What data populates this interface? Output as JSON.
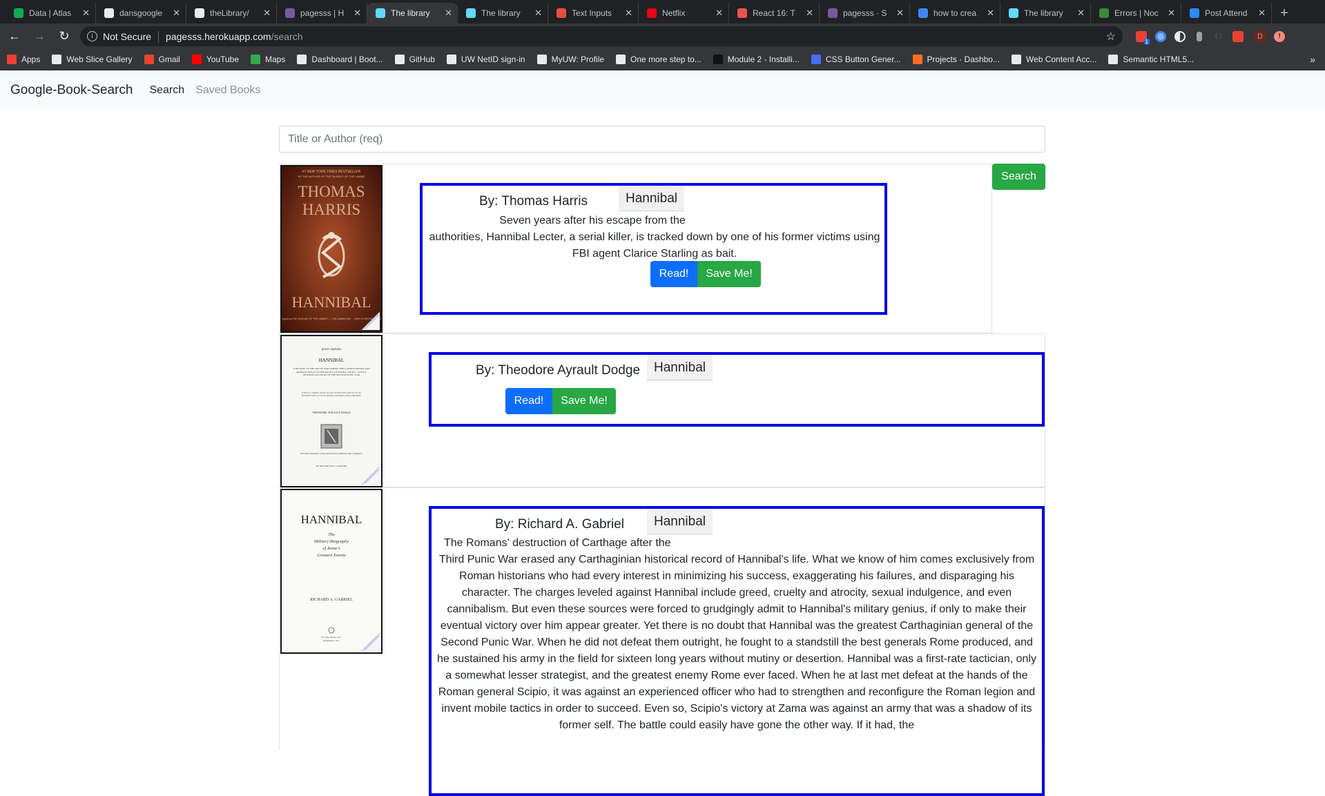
{
  "browser": {
    "tabs": [
      {
        "label": "Data | Atlas",
        "icon": "leaf-icon",
        "color": "#13aa52"
      },
      {
        "label": "dansgoogle",
        "icon": "github-icon",
        "color": "#e8eaed"
      },
      {
        "label": "theLibrary/",
        "icon": "github-icon",
        "color": "#e8eaed"
      },
      {
        "label": "pagesss | H",
        "icon": "heroku-icon",
        "color": "#79589f"
      },
      {
        "label": "The library",
        "icon": "react-icon",
        "color": "#61dafb",
        "active": true
      },
      {
        "label": "The library",
        "icon": "react-icon",
        "color": "#61dafb"
      },
      {
        "label": "Text Inputs",
        "icon": "mui-icon",
        "color": "#e84e40"
      },
      {
        "label": "Netflix",
        "icon": "netflix-icon",
        "color": "#e50914"
      },
      {
        "label": "React 16: T",
        "icon": "udemy-icon",
        "color": "#ec5252"
      },
      {
        "label": "pagesss · S",
        "icon": "heroku-icon",
        "color": "#79589f"
      },
      {
        "label": "how to crea",
        "icon": "google-icon",
        "color": "#4285f4"
      },
      {
        "label": "The library",
        "icon": "react-icon",
        "color": "#61dafb"
      },
      {
        "label": "Errors | Noc",
        "icon": "node-icon",
        "color": "#3c873a"
      },
      {
        "label": "Post Attend",
        "icon": "zoom-icon",
        "color": "#2d8cff"
      }
    ],
    "address": {
      "security": "Not Secure",
      "host": "pagesss.herokuapp.com",
      "path": "/search"
    },
    "profile_initial": "D",
    "extension_badge": "1",
    "bookmarks": [
      {
        "label": "Apps",
        "icon": "apps-grid-icon",
        "color": "#ea4335"
      },
      {
        "label": "Web Slice Gallery",
        "icon": "web-slice-icon",
        "color": "#e8eaed"
      },
      {
        "label": "Gmail",
        "icon": "gmail-icon",
        "color": "#ea4335"
      },
      {
        "label": "YouTube",
        "icon": "youtube-icon",
        "color": "#ff0000"
      },
      {
        "label": "Maps",
        "icon": "maps-icon",
        "color": "#34a853"
      },
      {
        "label": "Dashboard | Boot...",
        "icon": "bootcamp-icon",
        "color": "#e8eaed"
      },
      {
        "label": "GitHub",
        "icon": "github-icon",
        "color": "#e8eaed"
      },
      {
        "label": "UW NetID sign-in",
        "icon": "uw-icon",
        "color": "#e8eaed"
      },
      {
        "label": "MyUW: Profile",
        "icon": "uw-icon",
        "color": "#e8eaed"
      },
      {
        "label": "One more step to...",
        "icon": "uw-icon",
        "color": "#e8eaed"
      },
      {
        "label": "Module 2 - Installi...",
        "icon": "module-icon",
        "color": "#111111"
      },
      {
        "label": "CSS Button Gener...",
        "icon": "css-icon",
        "color": "#4a6cf7"
      },
      {
        "label": "Projects · Dashbo...",
        "icon": "gitlab-icon",
        "color": "#fc6d26"
      },
      {
        "label": "Web Content Acc...",
        "icon": "w3c-icon",
        "color": "#e8eaed"
      },
      {
        "label": "Semantic HTML5...",
        "icon": "semantic-icon",
        "color": "#e8eaed"
      }
    ]
  },
  "app": {
    "brand": "Google-Book-Search",
    "nav": {
      "search": "Search",
      "saved": "Saved Books"
    },
    "search": {
      "placeholder": "Title or Author (req)",
      "button": "Search"
    },
    "buttons": {
      "read": "Read!",
      "save": "Save Me!"
    },
    "results": [
      {
        "author": "By: Thomas Harris",
        "title": "Hannibal",
        "description_first": "Seven years after his escape from the",
        "description_rest": "authorities, Hannibal Lecter, a serial killer, is tracked down by one of his former victims using FBI agent Clarice Starling as bait.",
        "cover": {
          "top": "#1 NEW YORK TIMES BESTSELLER",
          "sub": "BY THE AUTHOR OF THE SILENCE OF THE LAMBS",
          "name1": "THOMAS",
          "name2": "HARRIS",
          "title": "HANNIBAL",
          "quote": "\"It is as good as THE SILENCE OF THE LAMBS!\" — THE LAMBS ARE ... WHO IS WRITING ... LONDON"
        }
      },
      {
        "author": "By: Theodore Ayrault Dodge",
        "title": "Hannibal",
        "cover": {
          "series": "great captains",
          "title": "HANNIBAL",
          "subtitle": "A HISTORY OF THE ART OF WAR AMONG THE CARTHAGINIANS AND ROMANS DOWN TO THE BATTLE OF PYDNA, 168 B.C., WITH A DETAILED ACCOUNT OF THE SECOND PUNIC WAR",
          "note": "WITH 227 CHARTS, MAPS, PLANS OF BATTLES AND TACTICAL MANOEUVRES, CUTS OF ARMOR, WEAPONS, AND UNIFORMS",
          "by": "THEODORE AYRAULT DODGE",
          "publisher": "BOSTON AND NEW YORK HOUGHTON, MIFFLIN AND COMPANY",
          "press": "The Riverside Press, Cambridge"
        }
      },
      {
        "author": "By: Richard A. Gabriel",
        "title": "Hannibal",
        "description_first": "The Romans' destruction of Carthage after the",
        "description_rest": "Third Punic War erased any Carthaginian historical record of Hannibal's life. What we know of him comes exclusively from Roman historians who had every interest in minimizing his success, exaggerating his failures, and disparaging his character. The charges leveled against Hannibal include greed, cruelty and atrocity, sexual indulgence, and even cannibalism. But even these sources were forced to grudgingly admit to Hannibal's military genius, if only to make their eventual victory over him appear greater. Yet there is no doubt that Hannibal was the greatest Carthaginian general of the Second Punic War. When he did not defeat them outright, he fought to a standstill the best generals Rome produced, and he sustained his army in the field for sixteen long years without mutiny or desertion. Hannibal was a first-rate tactician, only a somewhat lesser strategist, and the greatest enemy Rome ever faced. When he at last met defeat at the hands of the Roman general Scipio, it was against an experienced officer who had to strengthen and reconfigure the Roman legion and invent mobile tactics in order to succeed. Even so, Scipio's victory at Zama was against an army that was a shadow of its former self. The battle could easily have gone the other way. If it had, the",
        "cover": {
          "title": "HANNIBAL",
          "subtitle1": "The",
          "subtitle2": "Military Biography",
          "subtitle3": "of Rome's",
          "subtitle4": "Greatest Enemy",
          "author": "RICHARD A. GABRIEL",
          "publisher": "Potomac Books, Inc.",
          "place": "Washington, D.C."
        }
      }
    ]
  }
}
